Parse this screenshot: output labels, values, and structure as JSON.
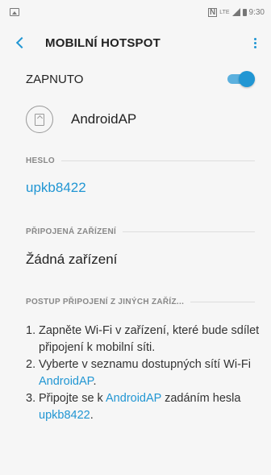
{
  "status_bar": {
    "time": "9:30",
    "nfc": "N",
    "network": "LTE"
  },
  "app_bar": {
    "title": "MOBILNÍ HOTSPOT"
  },
  "toggle": {
    "label": "ZAPNUTO",
    "on": true
  },
  "network": {
    "name": "AndroidAP"
  },
  "password_section": {
    "header": "HESLO",
    "value": "upkb8422"
  },
  "devices_section": {
    "header": "PŘIPOJENÁ ZAŘÍZENÍ",
    "empty_text": "Žádná zařízení"
  },
  "howto_section": {
    "header": "POSTUP PŘIPOJENÍ Z JINÝCH ZAŘÍZ...",
    "steps": [
      {
        "num": "1.",
        "text": "Zapněte Wi-Fi v zařízení, které bude sdílet připojení k mobilní síti."
      },
      {
        "num": "2.",
        "text_before": "Vyberte v seznamu dostupných sítí Wi-Fi ",
        "link": "AndroidAP",
        "text_after": "."
      },
      {
        "num": "3.",
        "text_before": "Připojte se k ",
        "link": "AndroidAP",
        "text_mid": " zadáním hesla ",
        "link2": "upkb8422",
        "text_after": "."
      }
    ]
  },
  "colors": {
    "accent": "#2196d3",
    "background": "#f6f6f6"
  }
}
